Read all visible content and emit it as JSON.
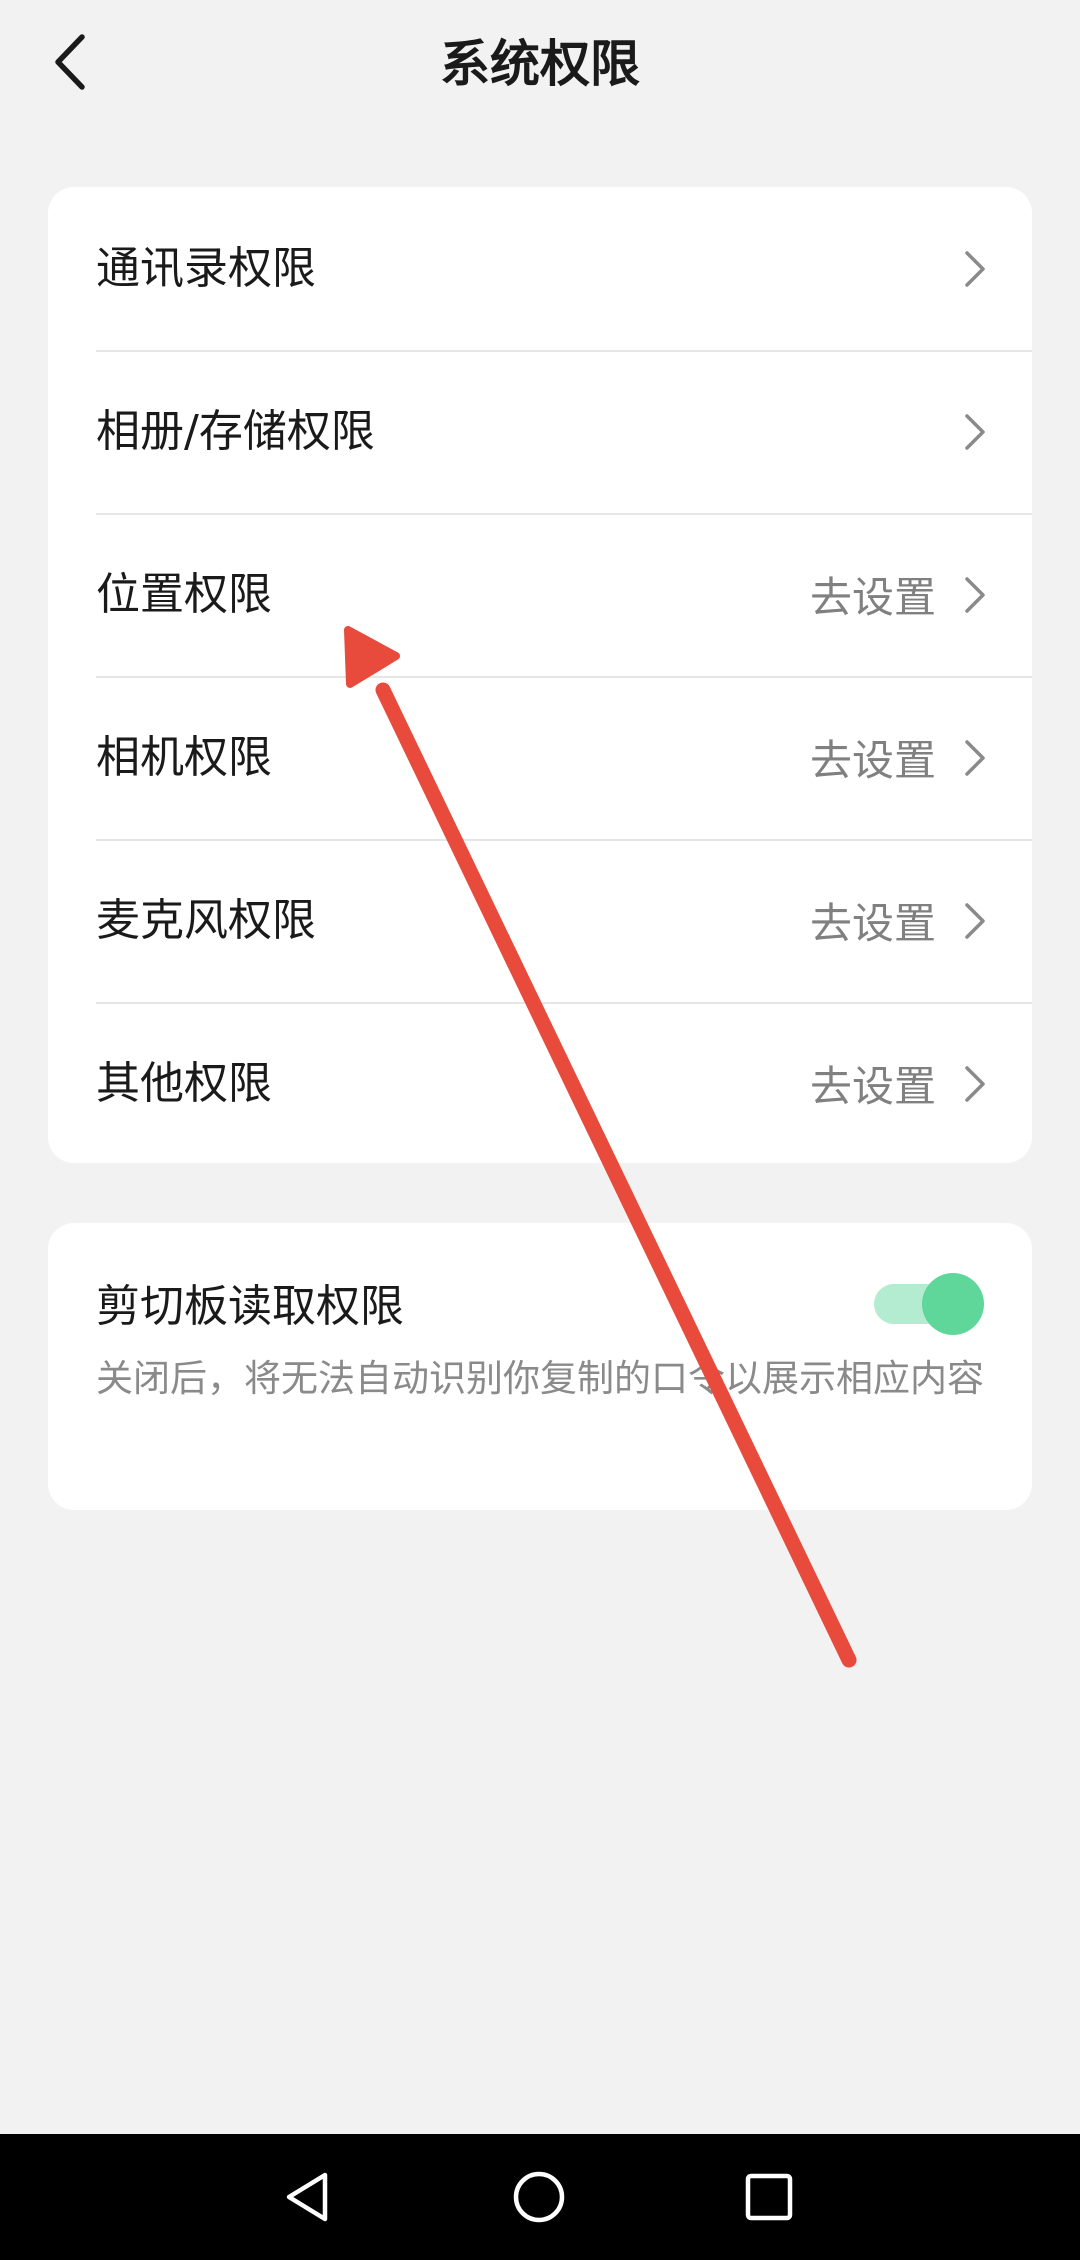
{
  "header": {
    "title": "系统权限"
  },
  "permissions": [
    {
      "label": "通讯录权限",
      "status": ""
    },
    {
      "label": "相册/存储权限",
      "status": ""
    },
    {
      "label": "位置权限",
      "status": "去设置"
    },
    {
      "label": "相机权限",
      "status": "去设置"
    },
    {
      "label": "麦克风权限",
      "status": "去设置"
    },
    {
      "label": "其他权限",
      "status": "去设置"
    }
  ],
  "clipboard": {
    "title": "剪切板读取权限",
    "description": "关闭后，将无法自动识别你复制的口令以展示相应内容",
    "enabled": true
  },
  "colors": {
    "background": "#f2f2f2",
    "card": "#ffffff",
    "toggle_on": "#5fd69a",
    "annotation_arrow": "#e84a3c"
  },
  "icons": {
    "back": "chevron-left-icon",
    "row_arrow": "chevron-right-icon",
    "nav_back": "triangle-back-icon",
    "nav_home": "circle-home-icon",
    "nav_recents": "square-recents-icon"
  }
}
